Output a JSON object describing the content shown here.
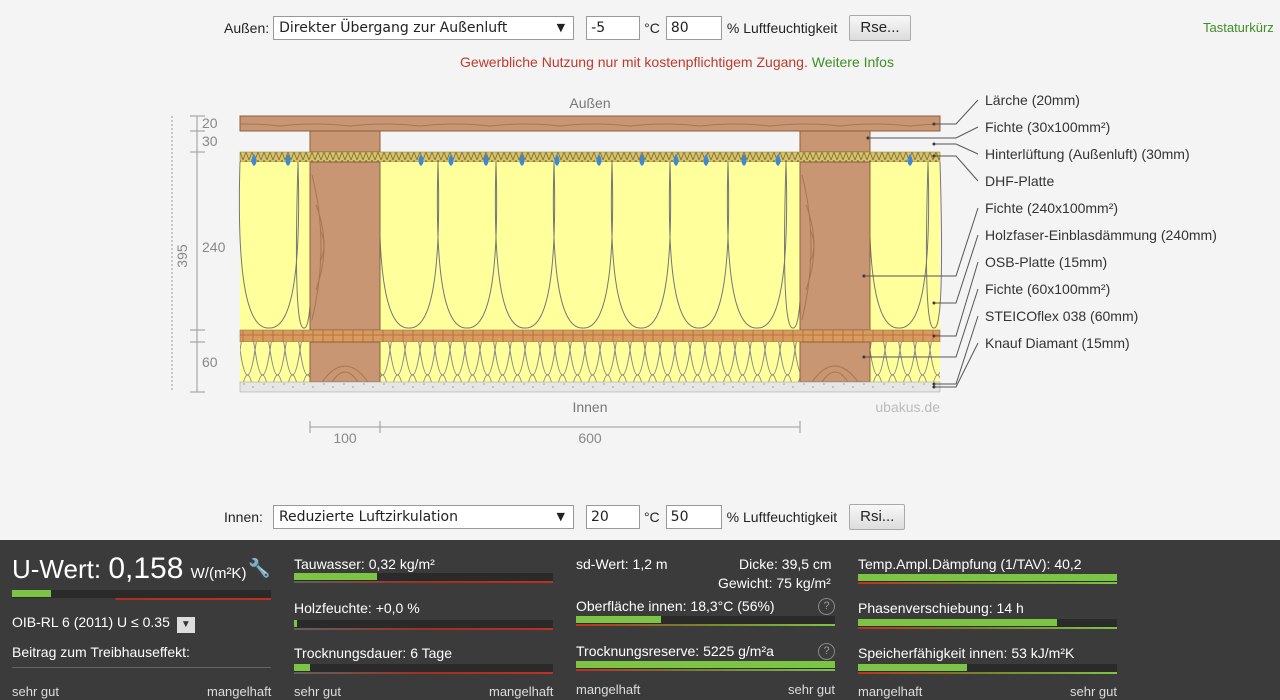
{
  "outside": {
    "label": "Außen:",
    "condition": "Direkter Übergang zur Außenluft",
    "temperature": "-5",
    "temp_unit": "°C",
    "humidity": "80",
    "humidity_unit": "% Luftfeuchtigkeit",
    "rs_button": "Rse..."
  },
  "inside": {
    "label": "Innen:",
    "condition": "Reduzierte Luftzirkulation",
    "temperature": "20",
    "temp_unit": "°C",
    "humidity": "50",
    "humidity_unit": "% Luftfeuchtigkeit",
    "rs_button": "Rsi..."
  },
  "shortcut_link": "Tastaturkürz",
  "notice": {
    "text": "Gewerbliche Nutzung nur mit kostenpflichtigem Zugang.",
    "link": "Weitere Infos"
  },
  "drawing": {
    "top_label": "Außen",
    "bottom_label": "Innen",
    "watermark": "ubakus.de",
    "dimensions_left": [
      "20",
      "30",
      "240",
      "60"
    ],
    "total_thickness": "395",
    "spacing": [
      "100",
      "600"
    ]
  },
  "layers": [
    "Lärche (20mm)",
    "Fichte (30x100mm²)",
    "Hinterlüftung (Außenluft) (30mm)",
    "DHF-Platte",
    "Fichte (240x100mm²)",
    "Holzfaser-Einblasdämmung (240mm)",
    "OSB-Platte (15mm)",
    "Fichte (60x100mm²)",
    "STEICOflex 038 (60mm)",
    "Knauf Diamant (15mm)"
  ],
  "results": {
    "u_label": "U-Wert:",
    "u_value": "0,158",
    "u_unit": "W/(m²K)",
    "u_fraction": 0.15,
    "requirement": "OIB-RL 6 (2011) U ≤ 0.35",
    "greenhouse": "Beitrag zum Treibhauseffekt:",
    "col1_left": "sehr gut",
    "col1_right": "mangelhaft",
    "condensate": "Tauwasser: 0,32 kg/m²",
    "condensate_fraction": 0.32,
    "wood_moisture": "Holzfeuchte: +0,0 %",
    "wood_moisture_fraction": 0.01,
    "drying_time": "Trocknungsdauer: 6 Tage",
    "drying_time_fraction": 0.06,
    "col2_left": "sehr gut",
    "col2_right": "mangelhaft",
    "sd_value": "sd-Wert: 1,2 m",
    "thickness": "Dicke: 39,5 cm",
    "weight": "Gewicht: 75 kg/m²",
    "surface_inside": "Oberfläche innen: 18,3°C (56%)",
    "surface_fraction": 0.33,
    "drying_reserve": "Trocknungsreserve: 5225 g/m²a",
    "drying_reserve_fraction": 1.0,
    "col3_left": "mangelhaft",
    "col3_right": "sehr gut",
    "temp_damping": "Temp.Ampl.Dämpfung (1/TAV): 40,2",
    "temp_damping_fraction": 1.0,
    "phase_shift": "Phasenverschiebung: 14 h",
    "phase_shift_fraction": 0.77,
    "heat_capacity": "Speicherfähigkeit innen: 53 kJ/m²K",
    "heat_capacity_fraction": 0.42,
    "col4_left": "mangelhaft",
    "col4_right": "sehr gut",
    "help_glyph": "?"
  },
  "colors": {
    "insulation": "#ffff99",
    "timber": "#c9956b",
    "osb": "#d4955a",
    "good": "#7cc443",
    "bad": "#c03020",
    "link": "#3e8e26",
    "notice": "#c0392b"
  }
}
